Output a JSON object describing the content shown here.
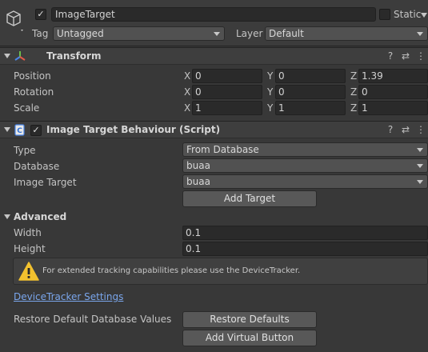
{
  "gameobject": {
    "active_check": "✓",
    "name": "ImageTarget",
    "static_label": "Static",
    "tag_label": "Tag",
    "tag_value": "Untagged",
    "layer_label": "Layer",
    "layer_value": "Default"
  },
  "transform": {
    "title": "Transform",
    "position_label": "Position",
    "rotation_label": "Rotation",
    "scale_label": "Scale",
    "axis_x": "X",
    "axis_y": "Y",
    "axis_z": "Z",
    "position": {
      "x": "0",
      "y": "0",
      "z": "1.39"
    },
    "rotation": {
      "x": "0",
      "y": "0",
      "z": "0"
    },
    "scale": {
      "x": "1",
      "y": "1",
      "z": "1"
    }
  },
  "image_target": {
    "title": "Image Target Behaviour (Script)",
    "enabled_check": "✓",
    "type_label": "Type",
    "type_value": "From Database",
    "database_label": "Database",
    "database_value": "buaa",
    "image_target_label": "Image Target",
    "image_target_value": "buaa",
    "add_target_label": "Add Target",
    "advanced_label": "Advanced",
    "width_label": "Width",
    "width_value": "0.1",
    "height_label": "Height",
    "height_value": "0.1",
    "help_text": "For extended tracking capabilities please use the DeviceTracker.",
    "device_tracker_link": "DeviceTracker Settings",
    "restore_label": "Restore Default Database Values",
    "restore_button": "Restore Defaults",
    "add_virtual_button": "Add Virtual Button"
  },
  "icons": {
    "gameobject": "cube-icon",
    "transform": "transform-axes-icon",
    "script": "script-icon",
    "help": "help-icon",
    "presets": "presets-sliders-icon",
    "menu": "kebab-menu-icon",
    "warning": "warning-icon"
  },
  "colors": {
    "background": "#383838",
    "field": "#2a2a2a",
    "link": "#7aa6ec",
    "warning": "#f2c12e",
    "axis_x": "#e25b4a",
    "axis_y": "#6cc04a",
    "axis_z": "#4a86e8"
  }
}
